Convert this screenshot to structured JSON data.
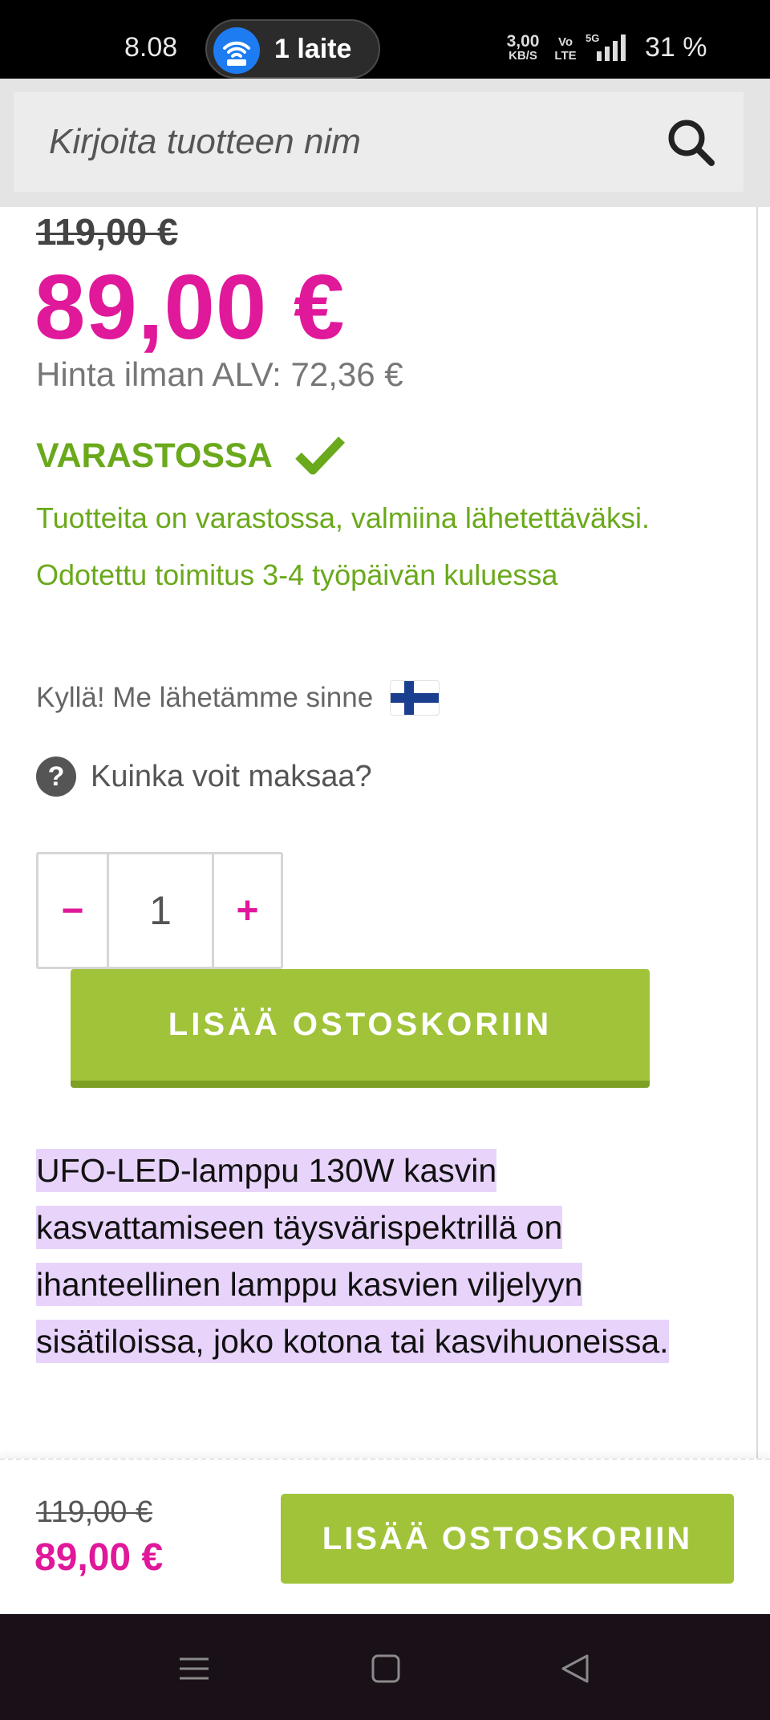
{
  "status_bar": {
    "time": "8.08",
    "hotspot_label": "1 laite",
    "net_speed": "3,00",
    "net_speed_unit": "KB/S",
    "volte_top": "Vo",
    "volte_bottom": "LTE",
    "network": "5G",
    "battery": "31 %"
  },
  "search": {
    "placeholder": "Kirjoita tuotteen nim"
  },
  "product": {
    "old_price": "119,00 €",
    "price": "89,00 €",
    "price_without_vat": "Hinta ilman ALV: 72,36 €",
    "stock_status": "VARASTOSSA",
    "stock_description": "Tuotteita on varastossa, valmiina lähetettäväksi. Odotettu toimitus 3-4 työpäivän kuluessa",
    "shipping_note": "Kyllä! Me lähetämme sinne",
    "payment_link": "Kuinka voit maksaa?",
    "help_glyph": "?",
    "quantity": "1",
    "decrement_label": "−",
    "increment_label": "+",
    "add_to_cart_label": "LISÄÄ OSTOSKORIIN",
    "description": "UFO-LED-lamppu 130W kasvin kasvattamiseen täysvärispektrillä on ihanteellinen lamppu kasvien viljelyyn sisätiloissa, joko kotona tai kasvihuoneissa."
  },
  "sticky_bar": {
    "old_price": "119,00 €",
    "price": "89,00 €",
    "add_to_cart_label": "LISÄÄ OSTOSKORIIN"
  },
  "colors": {
    "accent_pink": "#e0189a",
    "stock_green": "#6aa91b",
    "button_green": "#a0c33a",
    "highlight_purple": "#e8d4fb"
  },
  "icons": {
    "search": "search-icon",
    "check": "check-icon",
    "flag": "finland-flag-icon",
    "help": "help-circle-icon",
    "nav_menu": "menu-icon",
    "nav_home": "home-square-icon",
    "nav_back": "back-triangle-icon"
  }
}
